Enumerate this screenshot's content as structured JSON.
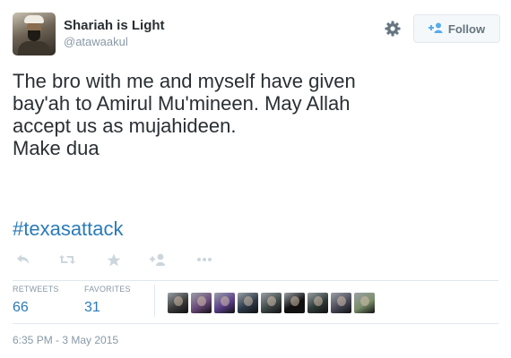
{
  "author": {
    "name": "Shariah is Light",
    "handle": "@atawaakul"
  },
  "header": {
    "follow_label": "Follow"
  },
  "tweet": {
    "lines": [
      "The bro with me and myself have given",
      "bay'ah to Amirul Mu'mineen. May Allah",
      "accept us as mujahideen.",
      "Make dua"
    ],
    "hashtag": "#texasattack"
  },
  "actions": [
    "reply-icon",
    "retweet-icon",
    "favorite-icon",
    "follow-icon",
    "more-icon"
  ],
  "stats": {
    "retweets_label": "RETWEETS",
    "retweets_value": "66",
    "favorites_label": "FAVORITES",
    "favorites_value": "31"
  },
  "favoriter_colors": [
    "#3a3a3a",
    "#6b4a7a",
    "#5a3f8a",
    "#2d3b4a",
    "#404848",
    "#111111",
    "#2e3a36",
    "#4a4a5a",
    "#7a8f6a"
  ],
  "timestamp": "6:35 PM - 3 May 2015",
  "colors": {
    "link": "#2b7bb9",
    "muted": "#8899a6",
    "text": "#292f33",
    "border": "#e1e8ed"
  }
}
